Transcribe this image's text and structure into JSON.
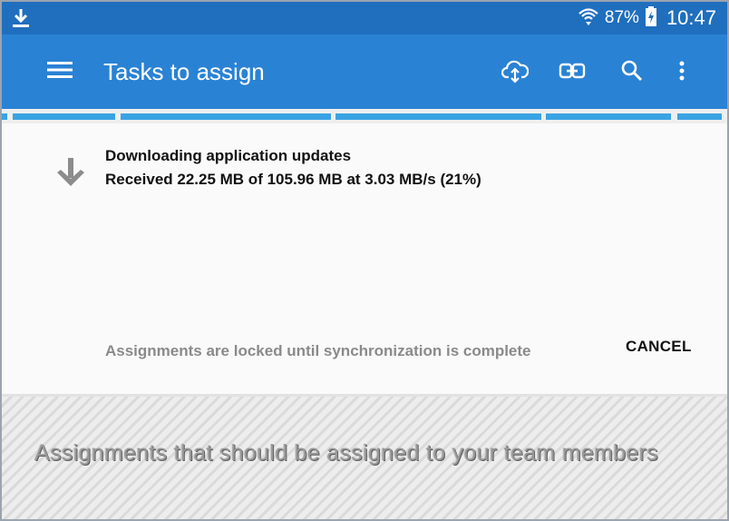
{
  "status_bar": {
    "battery": "87%",
    "time": "10:47",
    "icons": [
      "download-notification-icon",
      "wifi-icon",
      "battery-charging-icon"
    ]
  },
  "app_bar": {
    "title": "Tasks to assign",
    "icons": [
      "menu-icon",
      "cloud-sync-icon",
      "link-icon",
      "search-icon",
      "more-vert-icon"
    ]
  },
  "download": {
    "title": "Downloading application updates",
    "detail": "Received 22.25 MB of 105.96 MB at 3.03 MB/s (21%)",
    "progress_fraction": 0.21
  },
  "dialog": {
    "lock_message": "Assignments are locked until synchronization is complete",
    "cancel_label": "CANCEL"
  },
  "locked_area": {
    "text": "Assignments that should be assigned to your team members"
  },
  "colors": {
    "status_bar": "#1f6fbe",
    "app_bar": "#2a82d4",
    "progress": "#3aa3e3"
  }
}
